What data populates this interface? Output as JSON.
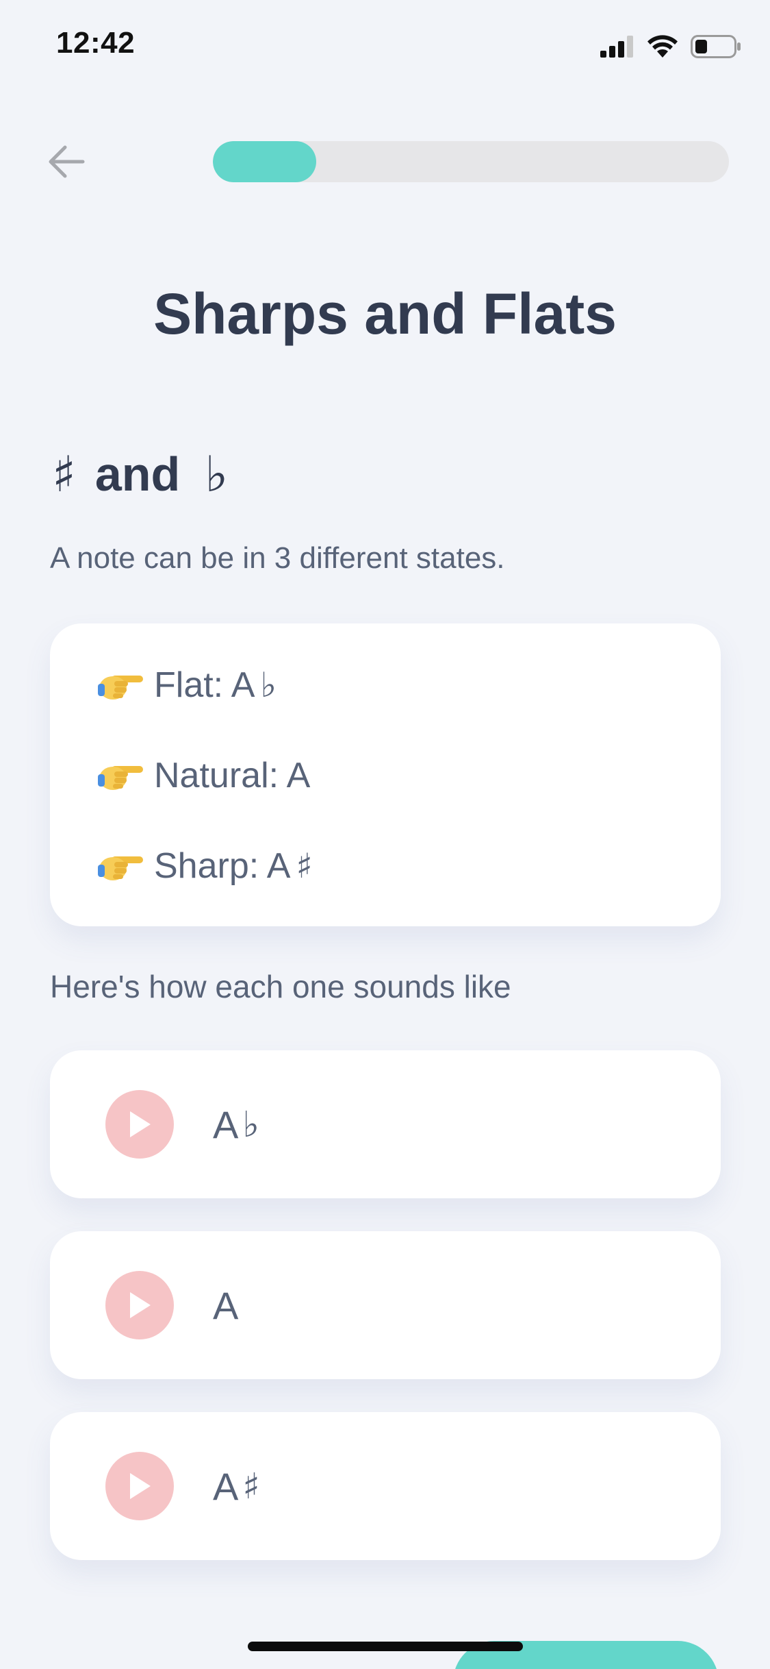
{
  "status_bar": {
    "time": "12:42",
    "icons": [
      "cellular-signal-icon",
      "wifi-icon",
      "battery-icon"
    ]
  },
  "nav": {
    "back_icon": "arrow-left-icon",
    "progress_fraction": 0.2
  },
  "page": {
    "title": "Sharps and Flats"
  },
  "section": {
    "sharp_symbol": "♯",
    "connector": "and",
    "flat_symbol": "♭"
  },
  "intro": {
    "text": "A note can be in 3 different states."
  },
  "states": [
    {
      "icon": "pointing-hand-icon",
      "label": "Flat: A",
      "symbol": "♭"
    },
    {
      "icon": "pointing-hand-icon",
      "label": "Natural: A",
      "symbol": ""
    },
    {
      "icon": "pointing-hand-icon",
      "label": "Sharp: A",
      "symbol": "♯"
    }
  ],
  "sounds": {
    "heading": "Here's how each one sounds like",
    "items": [
      {
        "icon": "play-icon",
        "note": "A",
        "symbol": "♭"
      },
      {
        "icon": "play-icon",
        "note": "A",
        "symbol": ""
      },
      {
        "icon": "play-icon",
        "note": "A",
        "symbol": "♯"
      }
    ]
  },
  "colors": {
    "accent": "#63d6ca",
    "play_button": "#f6c4c6",
    "background": "#f2f4f9",
    "title_text": "#323b50",
    "body_text": "#586378"
  }
}
